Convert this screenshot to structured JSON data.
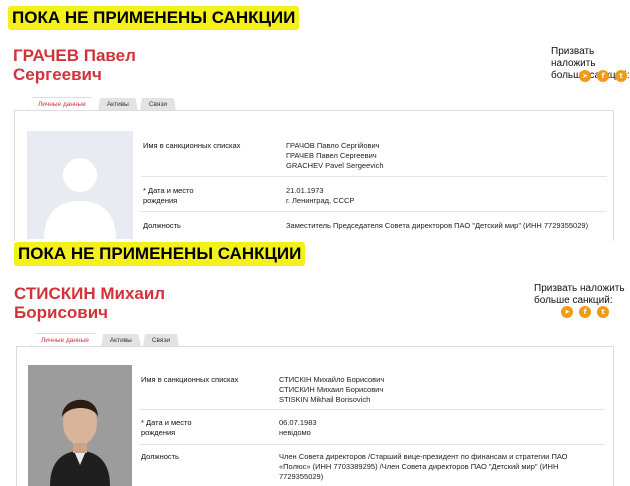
{
  "banner_top": "ПОКА НЕ ПРИМЕНЕНЫ САНКЦИИ",
  "banner_bottom": "ПОКА НЕ ПРИМЕНЕНЫ САНКЦИИ",
  "colors": {
    "highlight": "#f4f01a",
    "name_red": "#d0343a",
    "social_orange": "#f19a14"
  },
  "person1": {
    "name_line1": "ГРАЧЕВ Павел",
    "name_line2": "Сергеевич",
    "call_line1": "Призвать наложить",
    "call_line2": "больше санкций:",
    "tabs": [
      "Личные данные",
      "Активы",
      "Связи"
    ],
    "photo": "placeholder-avatar",
    "sanctions_label": "Имя в санкционных списках",
    "sanctions_names": [
      "ГРАЧОВ Павло Сергійович",
      "ГРАЧЕВ Павел Сергеевич",
      "GRACHEV Pavel Sergeevich"
    ],
    "birth_label_1": "* Дата и место",
    "birth_label_2": "рождения",
    "birth_date": "21.01.1973",
    "birth_place": "г. Ленинград, СССР",
    "position_label": "Должность",
    "position_value": "Заместитель Председателя Совета директоров ПАО \"Детский мир\" (ИНН 7729355029)"
  },
  "person2": {
    "name_line1": "СТИСКИН Михаил",
    "name_line2": "Борисович",
    "call_line1": "Призвать наложить",
    "call_line2": "больше санкций:",
    "tabs": [
      "Личные данные",
      "Активы",
      "Связи"
    ],
    "photo": "portrait-photo",
    "sanctions_label": "Имя в санкционных списках",
    "sanctions_names": [
      "СТИСКІН Михайло Борисович",
      "СТИСКИН Михаил Борисович",
      "STISKIN Mikhail Borisovich"
    ],
    "birth_label_1": "* Дата и место",
    "birth_label_2": "рождения",
    "birth_date": "06.07.1983",
    "birth_place": "невідомо",
    "position_label": "Должность",
    "position_lines": [
      "Член Совета директоров /Старший вице-президент по финансам и стратегии ПАО",
      "«Полюс» (ИНН 7703389295) /Член Совета директоров ПАО \"Детский мир\" (ИНН",
      "7729355029)"
    ]
  },
  "icons": [
    "telegram-icon",
    "facebook-icon",
    "twitter-icon"
  ]
}
